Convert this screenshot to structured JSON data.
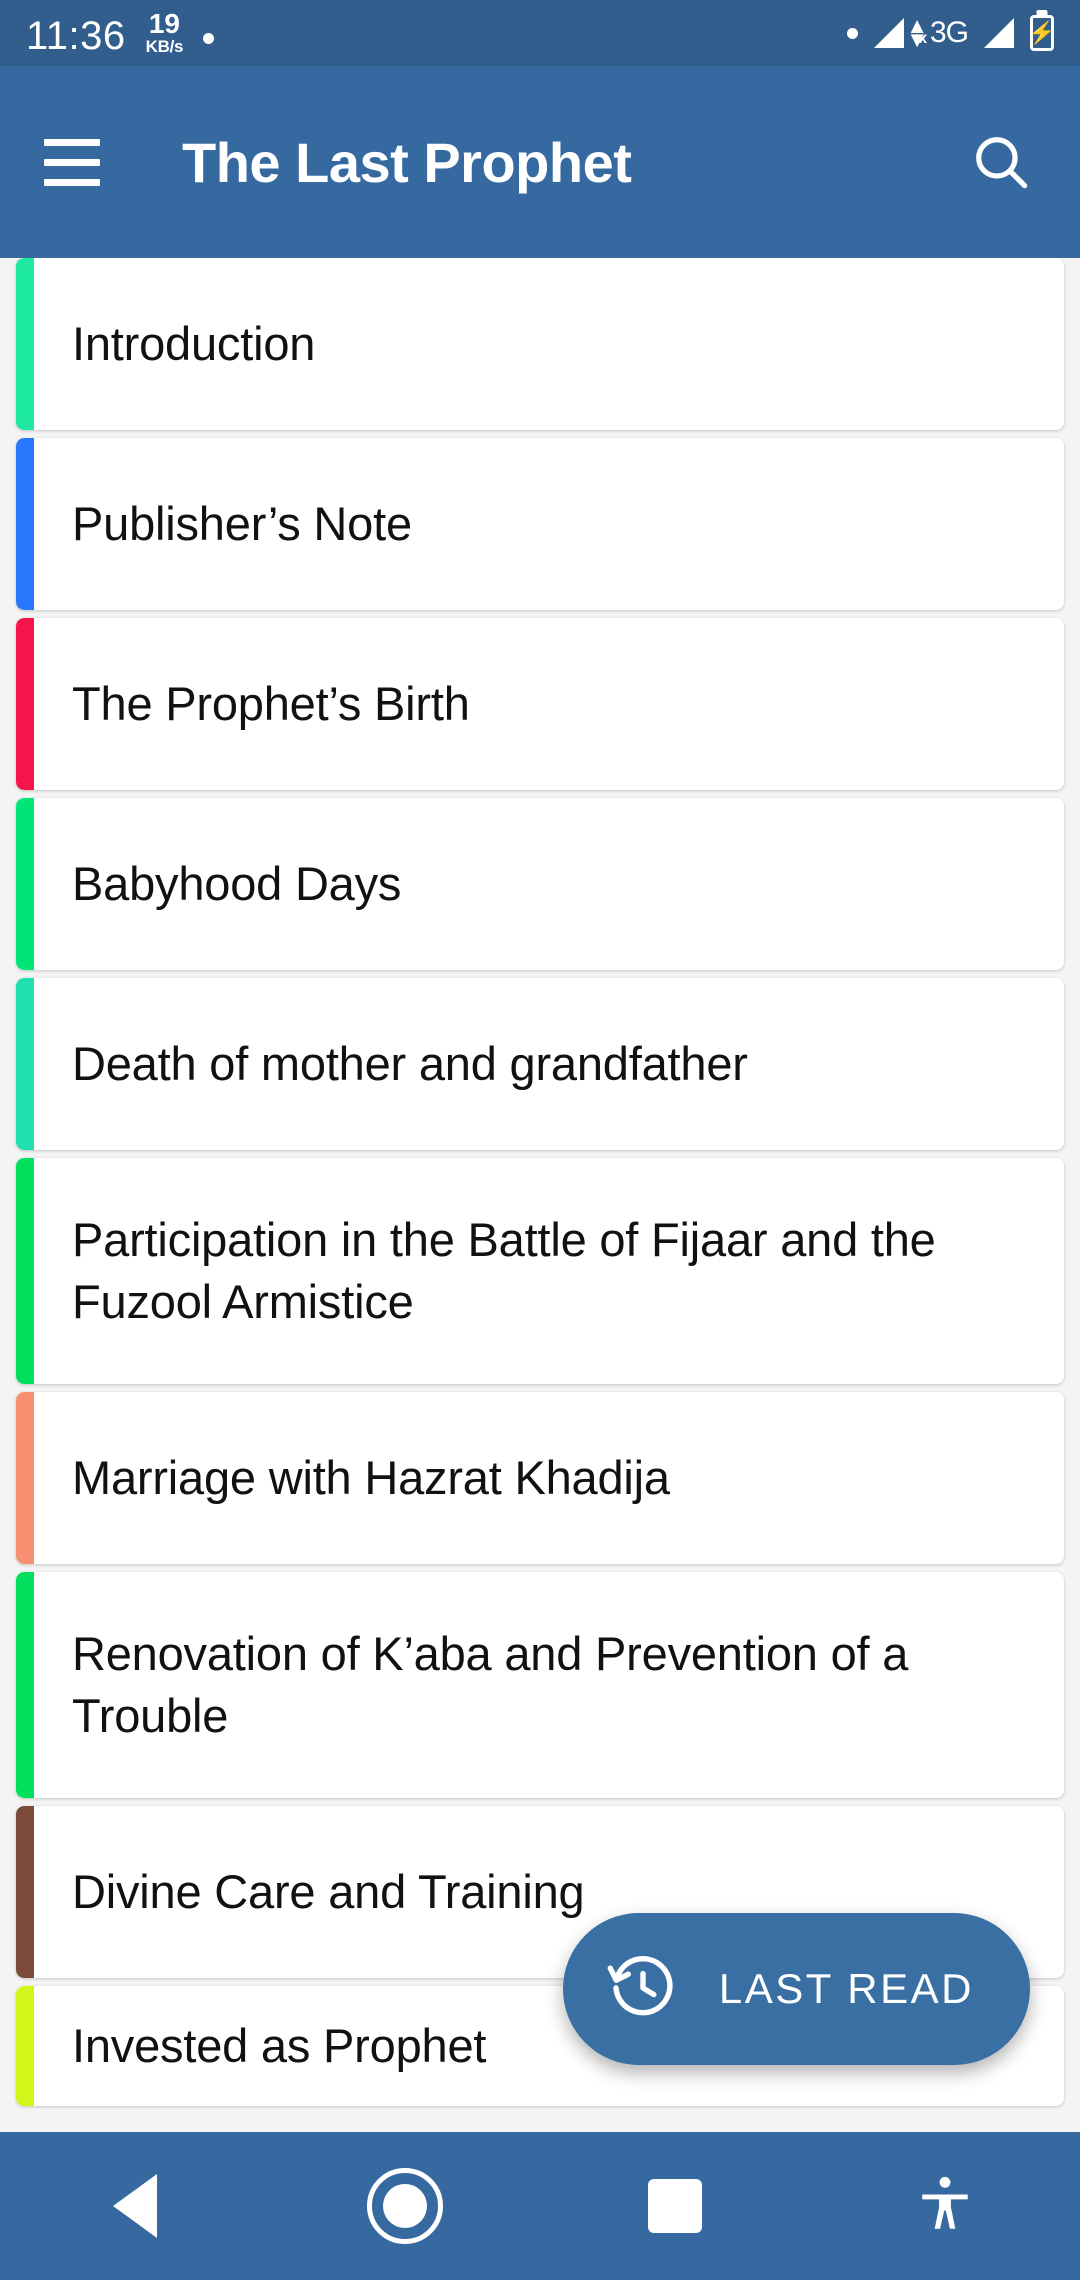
{
  "status_bar": {
    "time": "11:36",
    "net_speed_value": "19",
    "net_speed_unit": "KB/s",
    "network_type": "3G",
    "background": "#325E8E"
  },
  "app_bar": {
    "title": "The Last Prophet",
    "menu_icon": "hamburger-menu-icon",
    "search_icon": "search-icon",
    "background": "#36699F"
  },
  "chapters": [
    {
      "label": "Introduction",
      "color": "#1DE9A0",
      "lines": 1
    },
    {
      "label": "Publisher’s Note",
      "color": "#2979FF",
      "lines": 1
    },
    {
      "label": "The Prophet’s Birth",
      "color": "#F5174B",
      "lines": 1
    },
    {
      "label": "Babyhood Days",
      "color": "#00E676",
      "lines": 1
    },
    {
      "label": "Death of mother and grandfather",
      "color": "#20DFB0",
      "lines": 1
    },
    {
      "label": "Participation in the Battle of Fijaar and the Fuzool Armistice",
      "color": "#00E05C",
      "lines": 2
    },
    {
      "label": "Marriage with Hazrat Khadija",
      "color": "#F79070",
      "lines": 1
    },
    {
      "label": "Renovation of K’aba and Prevention of a Trouble",
      "color": "#00E05C",
      "lines": 2
    },
    {
      "label": "Divine Care and Training",
      "color": "#7A4B3A",
      "lines": 1
    },
    {
      "label": "Invested as Prophet",
      "color": "#D4F51A",
      "lines": 1
    }
  ],
  "fab": {
    "label": "LAST READ",
    "icon": "history-restore-icon",
    "background": "#3A6FA4"
  },
  "nav_bar": {
    "back_icon": "back-triangle-icon",
    "home_icon": "home-circle-icon",
    "recents_icon": "recents-square-icon",
    "accessibility_icon": "accessibility-person-icon",
    "background": "#36699F"
  }
}
